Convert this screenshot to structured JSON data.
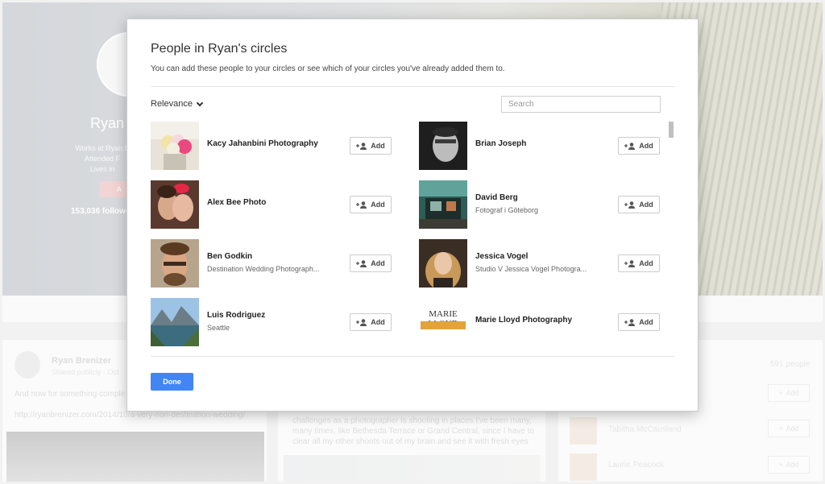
{
  "background": {
    "profile_name": "Ryan",
    "info_lines": [
      "Works at Ryan B",
      "Attended F",
      "Lives in"
    ],
    "follow_btn": "A",
    "followers": "153,036 followe",
    "post": {
      "author": "Ryan Brenizer",
      "shared": "Shared publicly · Oct",
      "text": "And now for something comple ready IN MY APARTMENT: Mor",
      "link": "http://ryanbrenizer.com/2014/10/a-very-non-destination-wedding/"
    },
    "post2_text": "challenges as a photographer is shooting in places I've been many, many times, like Bethesda Terrace or Grand Central, since I have to clear all my other shoots out of my brain and see it with fresh eyes",
    "people_count": "591 people",
    "people": [
      {
        "name": ""
      },
      {
        "name": "Tabitha McCausland"
      },
      {
        "name": "Laurie Peacock"
      }
    ],
    "add_label": "Add"
  },
  "dialog": {
    "title": "People in Ryan's circles",
    "subtitle": "You can add these people to your circles or see which of your circles you've already added them to.",
    "sort_label": "Relevance",
    "search_placeholder": "Search",
    "add_label": "Add",
    "done_label": "Done",
    "people": [
      {
        "name": "Kacy Jahanbini Photography",
        "desc": ""
      },
      {
        "name": "Brian Joseph",
        "desc": ""
      },
      {
        "name": "Alex Bee Photo",
        "desc": ""
      },
      {
        "name": "David Berg",
        "desc": "Fotograf i Göteborg"
      },
      {
        "name": "Ben Godkin",
        "desc": "Destination Wedding Photograph..."
      },
      {
        "name": "Jessica Vogel",
        "desc": "Studio V Jessica Vogel Photogra..."
      },
      {
        "name": "Luis Rodriguez",
        "desc": "Seattle"
      },
      {
        "name": "Marie Lloyd Photography",
        "desc": "",
        "logo_text": "MARIE LLOYD"
      }
    ]
  }
}
